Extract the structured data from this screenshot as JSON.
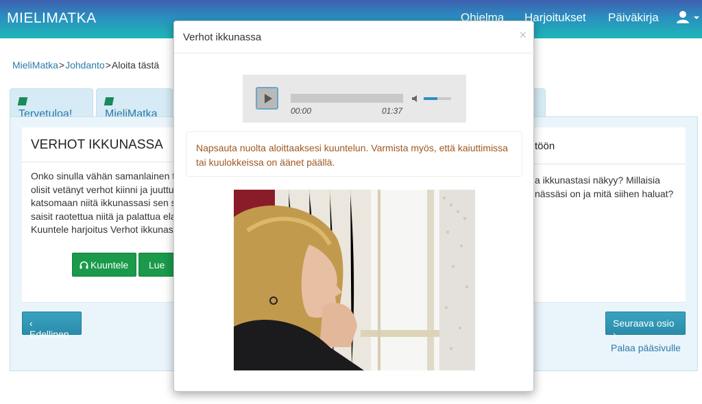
{
  "navbar": {
    "brand": "MIELIMATKA",
    "links": [
      "Ohjelma",
      "Harjoitukset",
      "Päiväkirja"
    ],
    "user_icon": "user-icon"
  },
  "breadcrumb": {
    "items": [
      "MieliMatka",
      "Johdanto",
      "Aloita tästä"
    ],
    "separator": ">"
  },
  "tabs": [
    {
      "label": "Tervetuloa!",
      "icon": "book-icon"
    },
    {
      "label": "MieliMatka",
      "icon": "book-icon"
    }
  ],
  "left_card": {
    "title": "VERHOT IKKUNASSA",
    "lines": [
      "Onko sinulla vähän samanlainen t",
      "olisit vetänyt verhot kiinni ja juuttu",
      "katsomaan niitä ikkunassasi sen s",
      "saisit raotettua niitä ja palattua ela",
      "Kuuntele harjoitus Verhot ikkunas"
    ],
    "listen_button": "Kuuntele",
    "read_button": "Lue"
  },
  "right_card": {
    "title_fragment": "töön",
    "lines": [
      "a ikkunastasi näkyy? Millaisia",
      "nässäsi on ja mitä siihen haluat?"
    ]
  },
  "footer": {
    "prev_button": "Edellinen",
    "next_button": "Seuraava osio",
    "home_link": "Palaa pääsivulle"
  },
  "modal": {
    "title": "Verhot ikkunassa",
    "close_glyph": "×",
    "player": {
      "current_time": "00:00",
      "duration": "01:37",
      "progress": 0,
      "volume": 0.5
    },
    "notice": "Napsauta nuolta aloittaaksesi kuuntelun. Varmista myös, että kaiuttimissa tai kuulokkeissa on äänet päällä."
  },
  "colors": {
    "navbar_top": "#3f5fb0",
    "navbar_bottom": "#1fb7b7",
    "green_button": "#1a9a4a",
    "blue_button": "#2a8cab",
    "link": "#2a7ba8",
    "notice_text": "#a0561e"
  }
}
